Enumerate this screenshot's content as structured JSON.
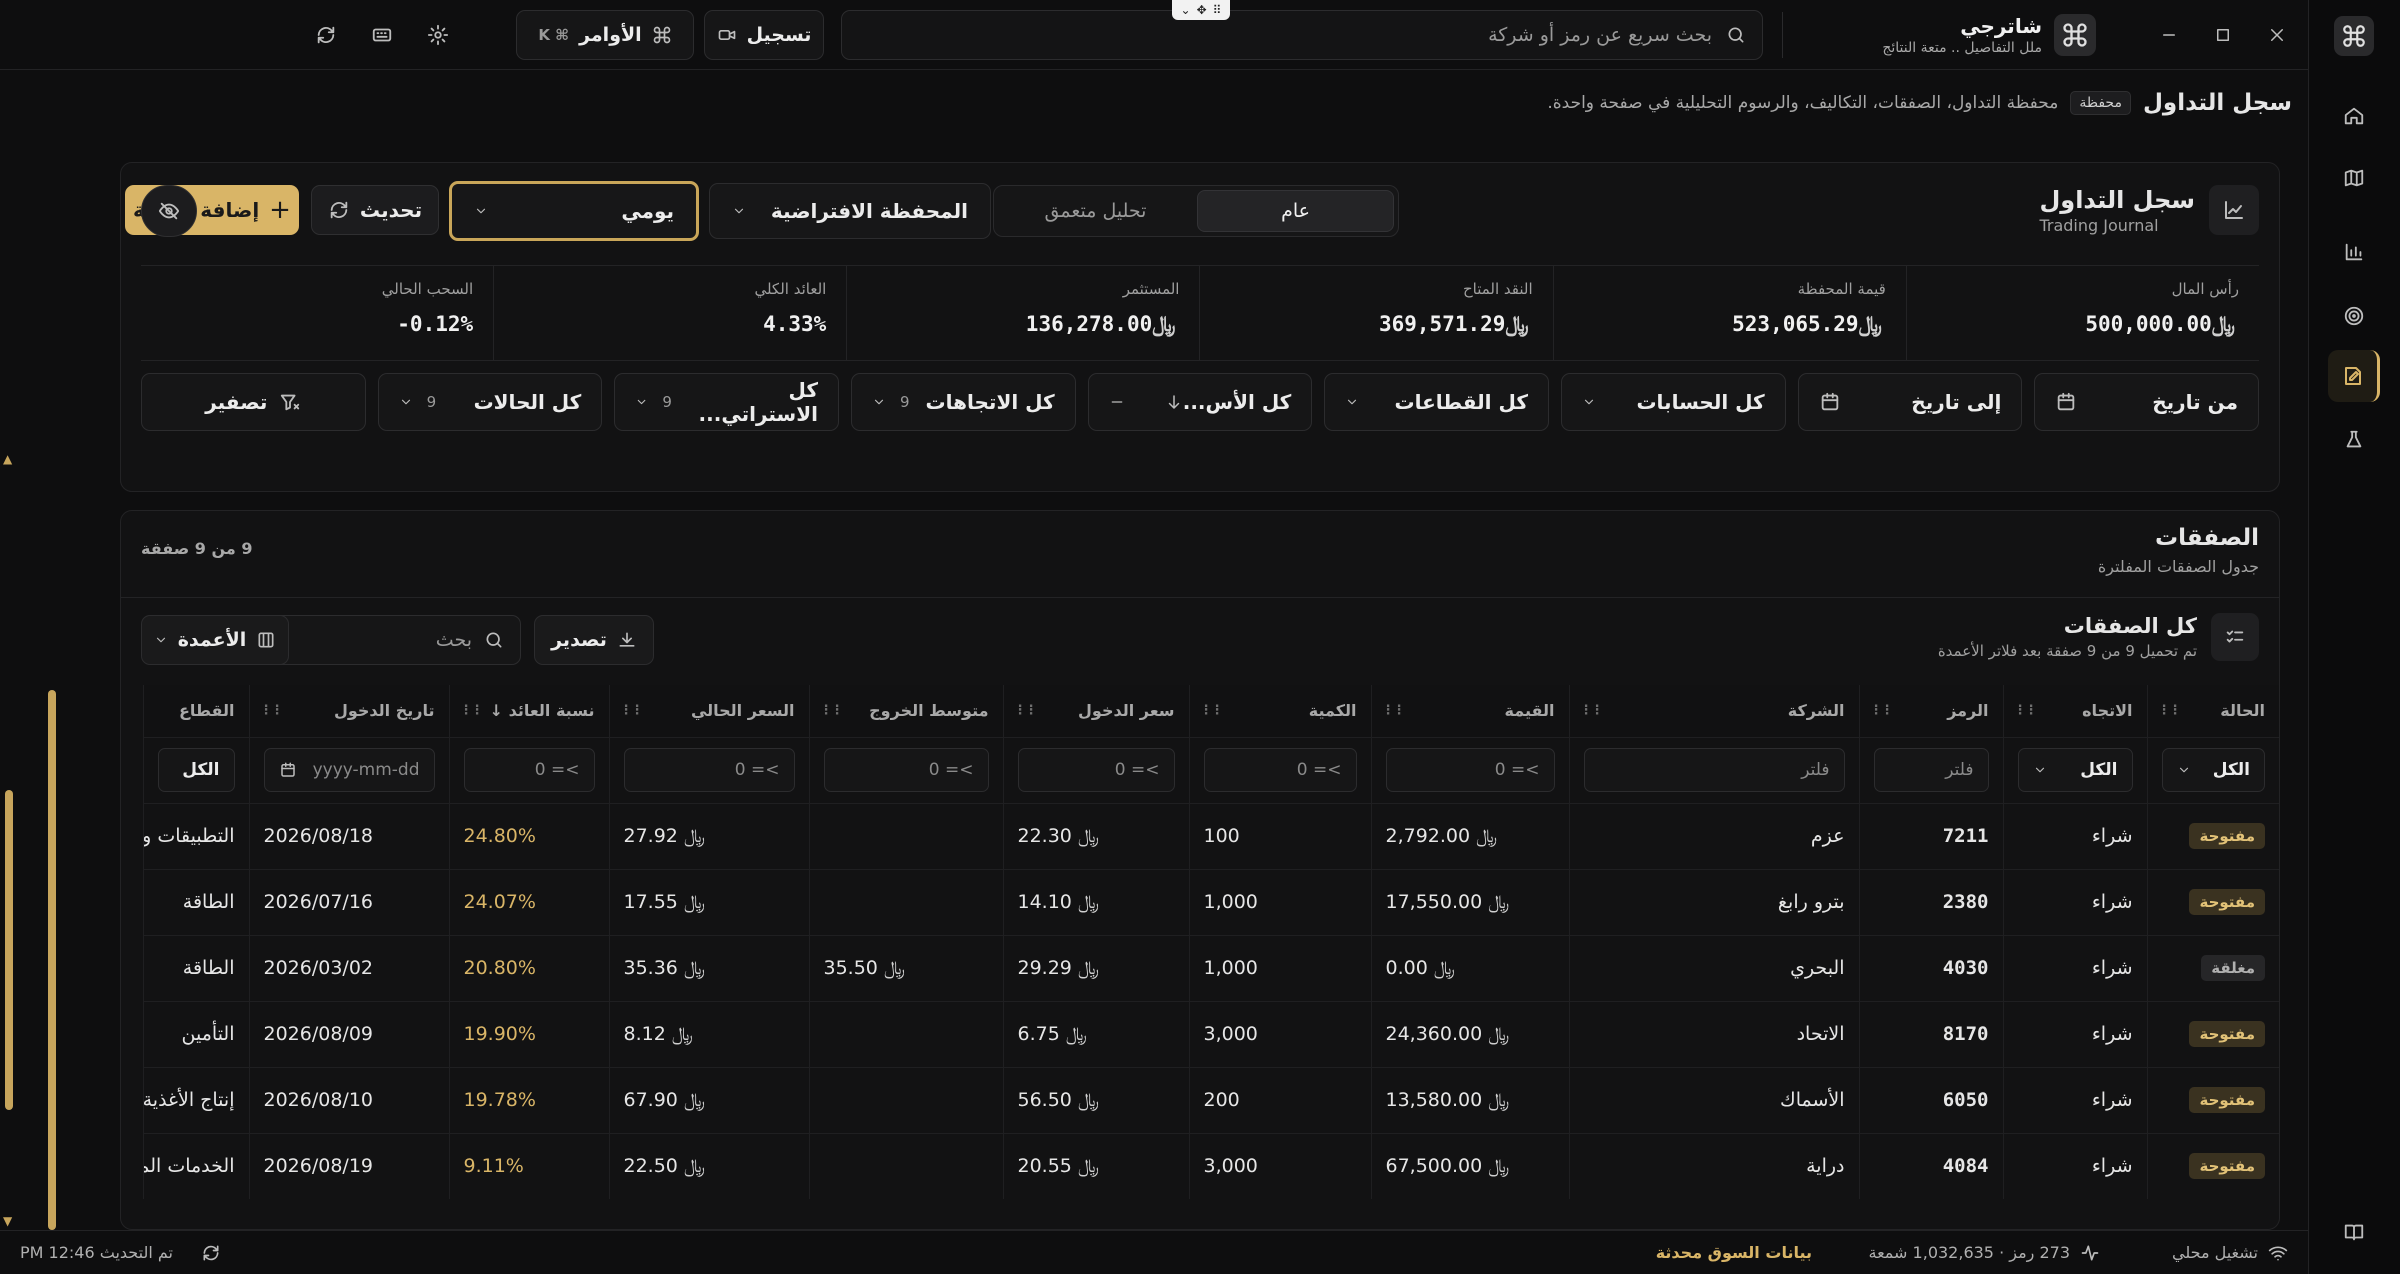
{
  "titlebar": {
    "brand_name": "شاترجي",
    "brand_tagline": "ملل التفاصيل .. متعة النتائج",
    "search_placeholder": "بحث سريع عن رمز أو شركة",
    "record_label": "تسجيل",
    "commands_label": "الأوامر",
    "commands_shortcut": "⌘ K"
  },
  "breadcrumb": {
    "title": "سجل التداول",
    "chip": "محفظة",
    "description": "محفظة التداول، الصفقات، التكاليف، والرسوم التحليلية في صفحة واحدة."
  },
  "panel": {
    "title": "سجل التداول",
    "subtitle": "Trading Journal",
    "tabs": [
      "عام",
      "تحليل متعمق"
    ],
    "active_tab": 0,
    "portfolio_select": "المحفظة الافتراضية",
    "period_select": "يومي",
    "refresh_label": "تحديث",
    "add_trade_label": "إضافة صفقة",
    "currency_symbol": "﷼",
    "stats": [
      {
        "label": "رأس المال",
        "value": "500,000.00",
        "currency": true
      },
      {
        "label": "قيمة المحفظة",
        "value": "523,065.29",
        "currency": true
      },
      {
        "label": "النقد المتاح",
        "value": "369,571.29",
        "currency": true
      },
      {
        "label": "المستثمر",
        "value": "136,278.00",
        "currency": true
      },
      {
        "label": "العائد الكلي",
        "value": "4.33%",
        "currency": false
      },
      {
        "label": "السحب الحالي",
        "value": "-0.12%",
        "currency": false
      }
    ],
    "filters": {
      "from_date": "من تاريخ",
      "to_date": "إلى تاريخ",
      "accounts": "كل الحسابات",
      "sectors": "كل القطاعات",
      "assets": "كل الأس...",
      "directions": "كل الاتجاهات",
      "directions_count": "9",
      "strategies": "كل الاستراتي...",
      "strategies_count": "9",
      "statuses": "كل الحالات",
      "statuses_count": "9",
      "reset": "تصفير"
    }
  },
  "trades": {
    "title": "الصفقات",
    "subtitle": "جدول الصفقات المفلترة",
    "count": "9 من 9 صفقة",
    "sub_title": "كل الصفقات",
    "sub_subtitle": "تم تحميل 9 من 9 صفقة بعد فلاتر الأعمدة",
    "search_placeholder": "بحث",
    "export_label": "تصدير",
    "columns_label": "الأعمدة",
    "headers": {
      "status": "الحالة",
      "direction": "الاتجاه",
      "symbol": "الرمز",
      "company": "الشركة",
      "value": "القيمة",
      "qty": "الكمية",
      "entry": "سعر الدخول",
      "exit": "متوسط الخروج",
      "current": "السعر الحالي",
      "return": "نسبة العائد ↓",
      "date": "تاريخ الدخول",
      "sector": "القطاع"
    },
    "filter_row": {
      "all": "الكل",
      "text_placeholder": "فلتر",
      "num_placeholder": ">= 0",
      "date_placeholder": "yyyy-mm-dd"
    },
    "rows": [
      {
        "status": "مفتوحة",
        "open": true,
        "direction": "شراء",
        "symbol": "7211",
        "company": "عزم",
        "value": "2,792.00",
        "qty": "100",
        "entry": "22.30",
        "exit": "",
        "current": "27.92",
        "ret": "24.80%",
        "date": "2026/08/18",
        "sector": "التطبيقات وخ"
      },
      {
        "status": "مفتوحة",
        "open": true,
        "direction": "شراء",
        "symbol": "2380",
        "company": "بترو رابغ",
        "value": "17,550.00",
        "qty": "1,000",
        "entry": "14.10",
        "exit": "",
        "current": "17.55",
        "ret": "24.07%",
        "date": "2026/07/16",
        "sector": "الطاقة"
      },
      {
        "status": "مغلقة",
        "open": false,
        "direction": "شراء",
        "symbol": "4030",
        "company": "البحري",
        "value": "0.00",
        "qty": "1,000",
        "entry": "29.29",
        "exit": "35.50",
        "current": "35.36",
        "ret": "20.80%",
        "date": "2026/03/02",
        "sector": "الطاقة"
      },
      {
        "status": "مفتوحة",
        "open": true,
        "direction": "شراء",
        "symbol": "8170",
        "company": "الاتحاد",
        "value": "24,360.00",
        "qty": "3,000",
        "entry": "6.75",
        "exit": "",
        "current": "8.12",
        "ret": "19.90%",
        "date": "2026/08/09",
        "sector": "التأمين"
      },
      {
        "status": "مفتوحة",
        "open": true,
        "direction": "شراء",
        "symbol": "6050",
        "company": "الأسماك",
        "value": "13,580.00",
        "qty": "200",
        "entry": "56.50",
        "exit": "",
        "current": "67.90",
        "ret": "19.78%",
        "date": "2026/08/10",
        "sector": "إنتاج الأغذية"
      },
      {
        "status": "مفتوحة",
        "open": true,
        "direction": "شراء",
        "symbol": "4084",
        "company": "دراية",
        "value": "67,500.00",
        "qty": "3,000",
        "entry": "20.55",
        "exit": "",
        "current": "22.50",
        "ret": "9.11%",
        "date": "2026/08/19",
        "sector": "الخدمات المال"
      }
    ]
  },
  "status": {
    "connection": "تشغيل محلي",
    "market": "273 رمز · 1,032,635 شمعة",
    "data_state": "بيانات السوق محدثة",
    "last_update": "تم التحديث 12:46 PM"
  }
}
